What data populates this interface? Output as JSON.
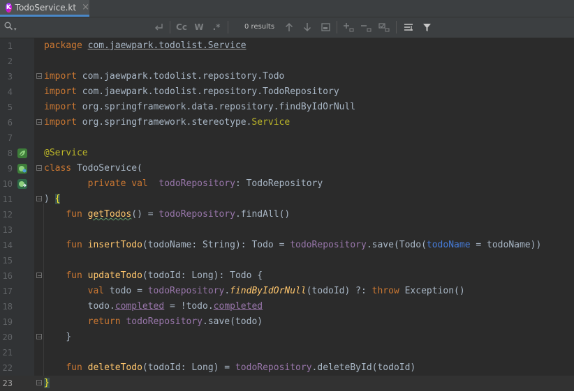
{
  "tab": {
    "filename": "TodoService.kt",
    "icon_letter": "K",
    "close_glyph": "×",
    "icon_name": "kotlin-file-icon"
  },
  "find": {
    "results": "0 results",
    "match_case": "Cc",
    "words": "W",
    "regex": ".*"
  },
  "colors": {
    "background": "#2b2b2b",
    "keyword": "#cc7832",
    "function": "#ffc66d",
    "property": "#9876aa",
    "annotation": "#bbb529",
    "default": "#a9b7c6",
    "accent": "#4a88c7"
  },
  "editor": {
    "current_line": 23,
    "lines": [
      {
        "n": "1",
        "t": {
          "kw": "package",
          "sp": " ",
          "pkg": "com.jaewpark.todolist.Service"
        }
      },
      {
        "n": "2"
      },
      {
        "n": "3",
        "t": {
          "kw": "import",
          "rest": " com.jaewpark.todolist.repository.Todo"
        }
      },
      {
        "n": "4",
        "t": {
          "kw": "import",
          "rest": " com.jaewpark.todolist.repository.TodoRepository"
        }
      },
      {
        "n": "5",
        "t": {
          "kw": "import",
          "rest": " org.springframework.data.repository.findByIdOrNull"
        }
      },
      {
        "n": "6",
        "t": {
          "kw": "import",
          "rest": " org.springframework.stereotype.",
          "ann": "Service"
        }
      },
      {
        "n": "7"
      },
      {
        "n": "8",
        "t": {
          "ann": "@Service"
        }
      },
      {
        "n": "9",
        "t": {
          "kw": "class",
          "rest": " TodoService("
        }
      },
      {
        "n": "10",
        "t": {
          "indent": "        ",
          "kw": "private val",
          "gap": "  ",
          "prop": "todoRepository",
          "rest": ": TodoRepository"
        }
      },
      {
        "n": "11",
        "t": {
          "a": ") ",
          "brace": "{"
        }
      },
      {
        "n": "12",
        "t": {
          "indent": "    ",
          "kw": "fun",
          "sp": " ",
          "fn": "getTodos",
          "a": "() = ",
          "prop": "todoRepository",
          "rest": ".findAll()"
        }
      },
      {
        "n": "13"
      },
      {
        "n": "14",
        "t": {
          "indent": "    ",
          "kw": "fun",
          "sp": " ",
          "fn": "insertTodo",
          "a": "(todoName: String): Todo = ",
          "prop": "todoRepository",
          "b": ".save(Todo(",
          "named": "todoName",
          "rest": " = todoName))"
        }
      },
      {
        "n": "15"
      },
      {
        "n": "16",
        "t": {
          "indent": "    ",
          "kw": "fun",
          "sp": " ",
          "fn": "updateTodo",
          "rest": "(todoId: Long): Todo {"
        }
      },
      {
        "n": "17",
        "t": {
          "indent": "        ",
          "kw": "val",
          "a": " todo = ",
          "prop": "todoRepository",
          "dot": ".",
          "fni": "findByIdOrNull",
          "b": "(todoId) ?: ",
          "kw2": "throw",
          "rest": " Exception()"
        }
      },
      {
        "n": "18",
        "t": {
          "indent": "        ",
          "a": "todo.",
          "p1": "completed",
          "b": " = !todo.",
          "p2": "completed"
        }
      },
      {
        "n": "19",
        "t": {
          "indent": "        ",
          "kw": "return",
          "sp": " ",
          "prop": "todoRepository",
          "rest": ".save(todo)"
        }
      },
      {
        "n": "20",
        "t": {
          "indent": "    ",
          "rest": "}"
        }
      },
      {
        "n": "21"
      },
      {
        "n": "22",
        "t": {
          "indent": "    ",
          "kw": "fun",
          "sp": " ",
          "fn": "deleteTodo",
          "a": "(todoId: Long) = ",
          "prop": "todoRepository",
          "rest": ".deleteById(todoId)"
        }
      },
      {
        "n": "23",
        "t": {
          "brace": "}"
        }
      }
    ]
  }
}
